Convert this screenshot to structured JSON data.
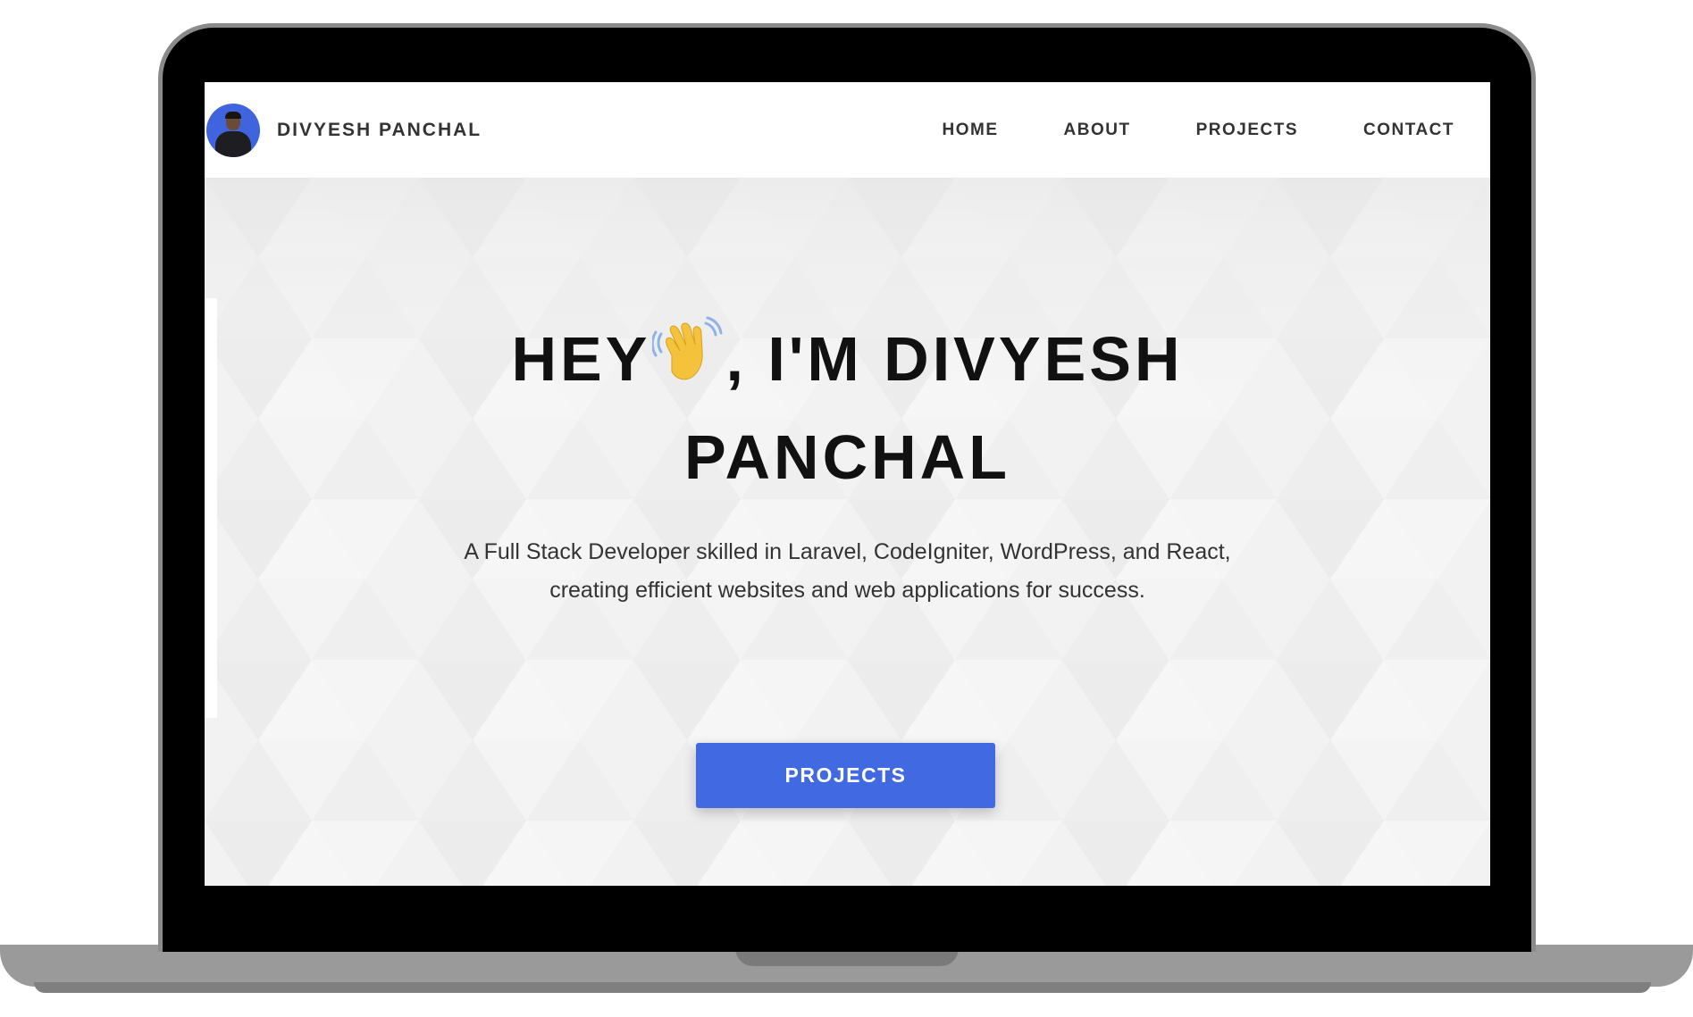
{
  "colors": {
    "accent": "#4169e1",
    "bezel": "#000000",
    "laptop_body": "#9a9a9a",
    "hero_background": "#f2f2f2",
    "text_dark": "#111111"
  },
  "navbar": {
    "brand_name": "DIVYESH PANCHAL",
    "avatar_icon": "profile-photo",
    "links": [
      {
        "label": "HOME"
      },
      {
        "label": "ABOUT"
      },
      {
        "label": "PROJECTS"
      },
      {
        "label": "CONTACT"
      }
    ]
  },
  "hero": {
    "title_before": "HEY",
    "title_emoji": "waving-hand-icon",
    "title_after_line1": ", I'M DIVYESH",
    "title_line2": "PANCHAL",
    "subtitle_line1": "A Full Stack Developer skilled in Laravel, CodeIgniter, WordPress, and React,",
    "subtitle_line2": "creating efficient websites and web applications for success.",
    "cta_label": "PROJECTS",
    "scroll_icon": "mouse-scroll-icon"
  }
}
